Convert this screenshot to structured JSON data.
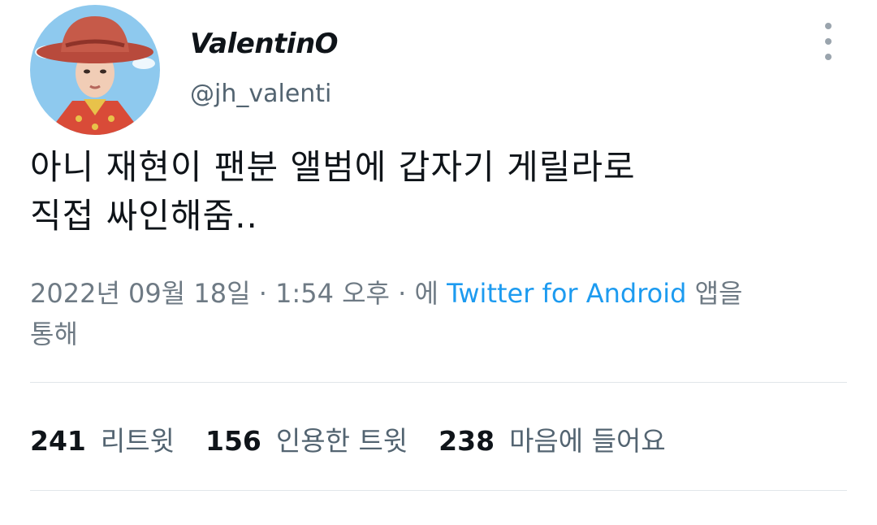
{
  "user": {
    "display_name": "ValentinO",
    "handle": "@jh_valenti",
    "avatar": "profile-photo-cowboy-hat"
  },
  "header": {
    "more_icon": "vertical-ellipsis-icon"
  },
  "tweet": {
    "text_lines": [
      "아니 재현이 팬분 앨범에 갑자기 게릴라로",
      "직접 싸인해줌.."
    ]
  },
  "meta": {
    "date": "2022년 09월 18일",
    "separator": " · ",
    "time": "1:54 오후",
    "prefix": "에 ",
    "source": "Twitter for Android",
    "suffix_line1": " 앱을",
    "suffix_line2": "통해"
  },
  "stats": {
    "retweets": {
      "count": "241",
      "label": "리트윗"
    },
    "quotes": {
      "count": "156",
      "label": "인용한 트윗"
    },
    "likes": {
      "count": "238",
      "label": "마음에 들어요"
    }
  },
  "colors": {
    "text": "#0f1419",
    "secondary": "#536471",
    "link": "#1d9bf0",
    "divider": "#e1e6ea"
  }
}
